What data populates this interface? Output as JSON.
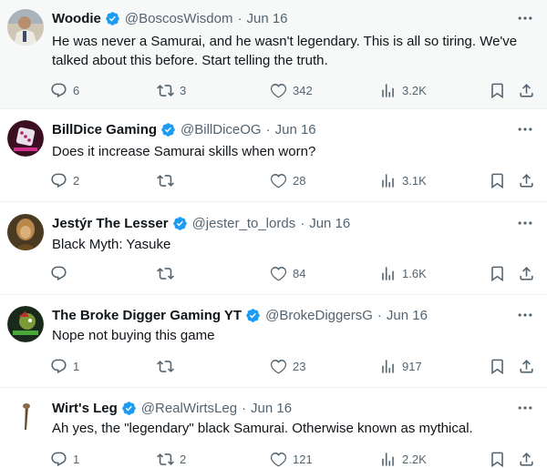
{
  "tweets": [
    {
      "name": "Woodie",
      "handle": "@BoscosWisdom",
      "date": "Jun 16",
      "text": "He was never a Samurai, and he wasn't legendary. This is all so tiring. We've talked about this before. Start telling the truth.",
      "replies": "6",
      "retweets": "3",
      "likes": "342",
      "views": "3.2K"
    },
    {
      "name": "BillDice Gaming",
      "handle": "@BillDiceOG",
      "date": "Jun 16",
      "text": "Does it increase Samurai skills when worn?",
      "replies": "2",
      "retweets": "",
      "likes": "28",
      "views": "3.1K"
    },
    {
      "name": "Jestýr The Lesser",
      "handle": "@jester_to_lords",
      "date": "Jun 16",
      "text": "Black Myth: Yasuke",
      "replies": "",
      "retweets": "",
      "likes": "84",
      "views": "1.6K"
    },
    {
      "name": "The Broke Digger Gaming YT",
      "handle": "@BrokeDiggersG",
      "date": "Jun 16",
      "text": "Nope not buying this game",
      "replies": "1",
      "retweets": "",
      "likes": "23",
      "views": "917"
    },
    {
      "name": "Wirt's Leg",
      "handle": "@RealWirtsLeg",
      "date": "Jun 16",
      "text": "Ah yes, the \"legendary\" black Samurai. Otherwise known as mythical.",
      "replies": "1",
      "retweets": "2",
      "likes": "121",
      "views": "2.2K"
    }
  ],
  "separator": "·",
  "colors": {
    "verified": "#1d9bf0",
    "secondary_text": "#536471",
    "primary_text": "#0f1419",
    "divider": "#eff3f4"
  },
  "icons": {
    "reply": "reply-icon",
    "retweet": "retweet-icon",
    "like": "like-icon",
    "views": "views-icon",
    "bookmark": "bookmark-icon",
    "share": "share-icon",
    "more": "more-icon",
    "verified": "verified-badge-icon"
  }
}
